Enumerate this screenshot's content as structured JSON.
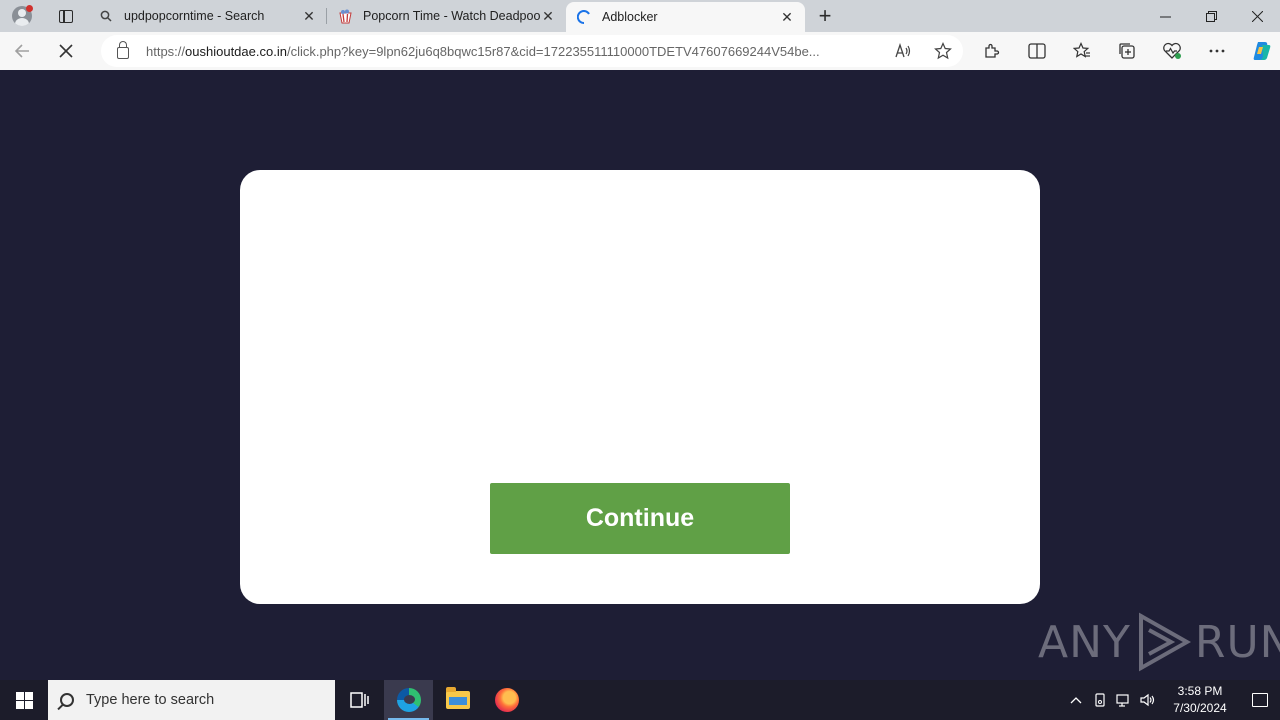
{
  "browser": {
    "tabs": [
      {
        "label": "updpopcorntime - Search",
        "icon": "search-icon",
        "close": "✕"
      },
      {
        "label": "Popcorn Time - Watch Deadpool",
        "icon": "popcorn-favicon-icon",
        "close": "✕"
      },
      {
        "label": "Adblocker",
        "icon": "loading-spinner-icon",
        "close": "✕"
      }
    ],
    "new_tab": "+",
    "window_controls": {
      "minimize": "—",
      "restore": "❐",
      "close": "✕"
    },
    "address": {
      "scheme": "https://",
      "domain": "oushioutdae.co.in",
      "path": "/click.php?key=9lpn62ju6q8bqwc15r87&cid=172235511110000TDETV47607669244V54be..."
    }
  },
  "page": {
    "continue_label": "Continue",
    "accent_color": "#60a046",
    "background_color": "#1e1e35"
  },
  "watermark": {
    "left": "ANY",
    "right": "RUN"
  },
  "taskbar": {
    "search_placeholder": "Type here to search",
    "time": "3:58 PM",
    "date": "7/30/2024"
  }
}
